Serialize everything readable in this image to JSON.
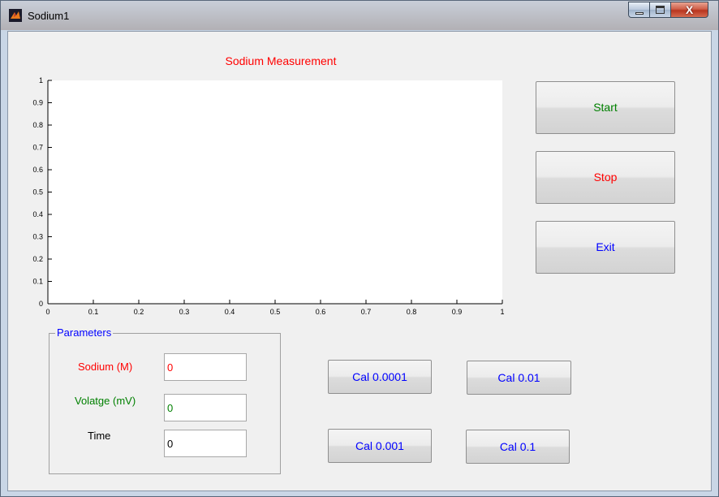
{
  "window": {
    "title": "Sodium1",
    "close_glyph": "X",
    "icons": [
      "matlab-icon",
      "minimize-icon",
      "maximize-icon",
      "close-icon"
    ]
  },
  "plot": {
    "title": "Sodium Measurement",
    "title_color": "#ff0000"
  },
  "chart_data": {
    "type": "line",
    "title": "Sodium Measurement",
    "xlabel": "",
    "ylabel": "",
    "xlim": [
      0,
      1
    ],
    "ylim": [
      0,
      1
    ],
    "x_ticks": [
      "0",
      "0.1",
      "0.2",
      "0.3",
      "0.4",
      "0.5",
      "0.6",
      "0.7",
      "0.8",
      "0.9",
      "1"
    ],
    "y_ticks": [
      "0",
      "0.1",
      "0.2",
      "0.3",
      "0.4",
      "0.5",
      "0.6",
      "0.7",
      "0.8",
      "0.9",
      "1"
    ],
    "grid": false,
    "series": []
  },
  "buttons": {
    "start": {
      "label": "Start",
      "color": "#008000"
    },
    "stop": {
      "label": "Stop",
      "color": "#ff0000"
    },
    "exit": {
      "label": "Exit",
      "color": "#0000ff"
    },
    "cal_0001": {
      "label": "Cal 0.0001",
      "color": "#0000ff"
    },
    "cal_001": {
      "label": "Cal 0.01",
      "color": "#0000ff"
    },
    "cal_0_001": {
      "label": "Cal 0.001",
      "color": "#0000ff"
    },
    "cal_01": {
      "label": "Cal 0.1",
      "color": "#0000ff"
    }
  },
  "parameters": {
    "title": "Parameters",
    "sodium": {
      "label": "Sodium (M)",
      "value": "0",
      "color": "#ff0000"
    },
    "voltage": {
      "label": "Volatge (mV)",
      "value": "0",
      "color": "#008000"
    },
    "time": {
      "label": "Time",
      "value": "0",
      "color": "#000000"
    }
  }
}
